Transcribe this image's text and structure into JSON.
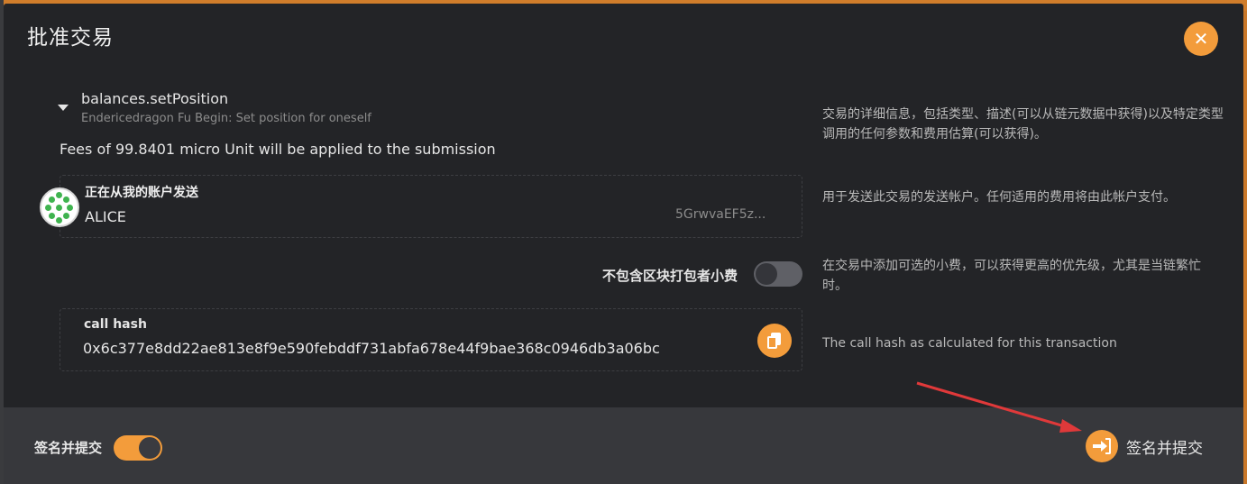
{
  "modal": {
    "title": "批准交易",
    "close_icon": "close-icon"
  },
  "call": {
    "method": "balances.setPosition",
    "description": "Endericedragon Fu Begin: Set position for oneself",
    "fees": "Fees of 99.8401 micro Unit will be applied to the submission",
    "help": "交易的详细信息，包括类型、描述(可以从链元数据中获得)以及特定类型调用的任何参数和费用估算(可以获得)。"
  },
  "account": {
    "label": "正在从我的账户发送",
    "name": "ALICE",
    "address": "5GrwvaEF5z...",
    "help": "用于发送此交易的发送帐户。任何适用的费用将由此帐户支付。"
  },
  "tip": {
    "label": "不包含区块打包者小费",
    "enabled": false,
    "help": "在交易中添加可选的小费，可以获得更高的优先级，尤其是当链繁忙时。"
  },
  "call_hash": {
    "label": "call hash",
    "value": "0x6c377e8dd22ae813e8f9e590febddf731abfa678e44f9bae368c0946db3a06bc",
    "help": "The call hash as calculated for this transaction"
  },
  "footer": {
    "sign_toggle_label": "签名并提交",
    "sign_enabled": true,
    "submit_label": "签名并提交"
  },
  "colors": {
    "accent": "#f39c3b",
    "modal_bg": "#232427",
    "footer_bg": "#37383c",
    "annotation_arrow": "#e0393a"
  }
}
